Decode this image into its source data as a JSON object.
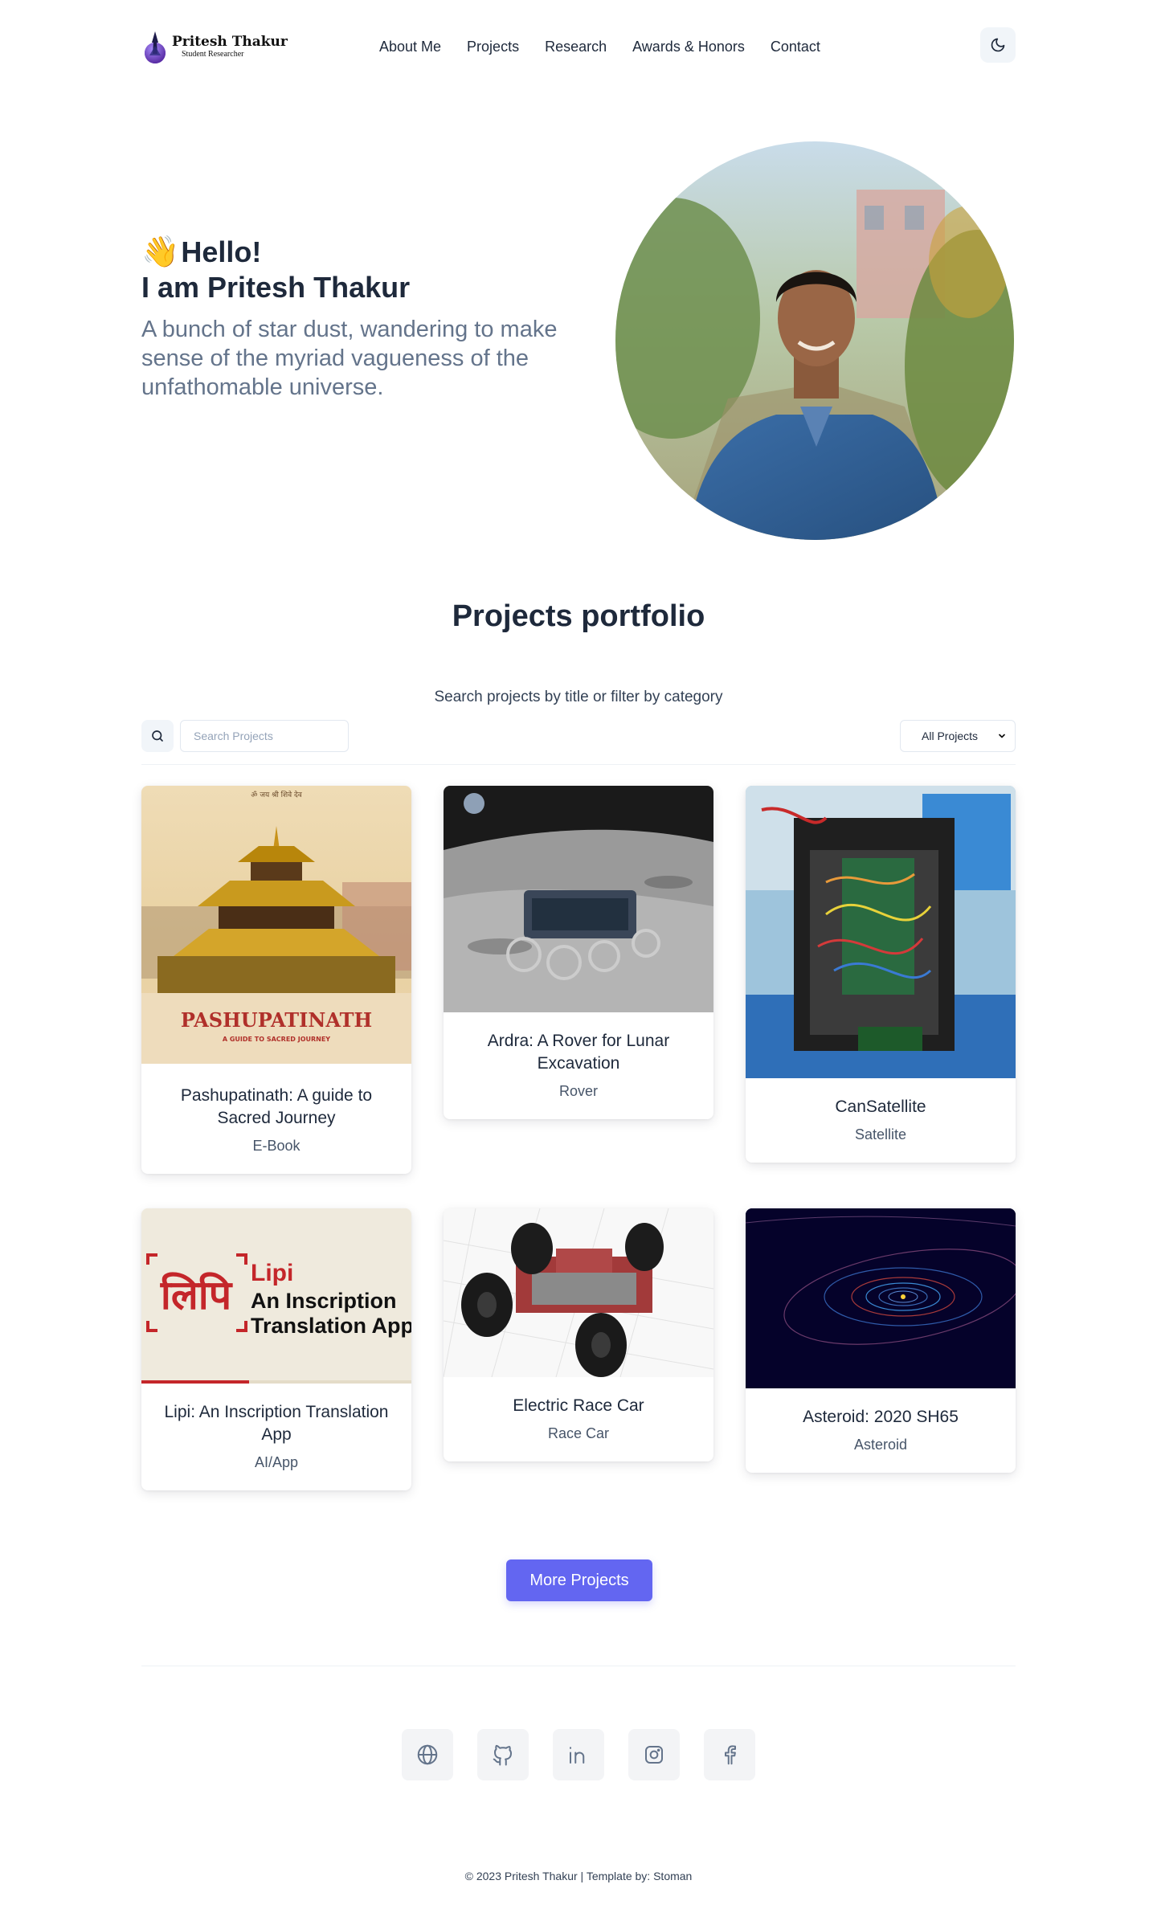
{
  "brand": {
    "name": "Pritesh Thakur",
    "subtitle": "Student Researcher",
    "accent": "#6366f1"
  },
  "nav": {
    "items": [
      "About Me",
      "Projects",
      "Research",
      "Awards & Honors",
      "Contact"
    ],
    "theme_toggle_icon": "moon-icon"
  },
  "hero": {
    "greeting_emoji": "👋",
    "greeting": "Hello!",
    "name_line": "I am Pritesh Thakur",
    "tagline": "A bunch of star dust, wandering to make sense of the myriad vagueness of the unfathomable universe."
  },
  "projects": {
    "title": "Projects portfolio",
    "search_hint": "Search projects by title or filter by category",
    "search_placeholder": "Search Projects",
    "filter_selected": "All Projects",
    "cards": [
      {
        "title": "Pashupatinath: A guide to Sacred Journey",
        "category": "E-Book",
        "cover_heading": "PASHUPATINATH",
        "cover_sub": "A GUIDE TO SACRED JOURNEY",
        "cover_top": "ॐ जय श्री शिवे देव"
      },
      {
        "title": "Ardra: A Rover for Lunar Excavation",
        "category": "Rover"
      },
      {
        "title": "CanSatellite",
        "category": "Satellite"
      },
      {
        "title": "Lipi: An Inscription Translation App",
        "category": "AI/App",
        "logo_word": "Lipi",
        "logo_line1": "An Inscription",
        "logo_line2": "Translation App",
        "logo_glyph": "लिपि"
      },
      {
        "title": "Electric Race Car",
        "category": "Race Car"
      },
      {
        "title": "Asteroid: 2020 SH65",
        "category": "Asteroid"
      }
    ],
    "more_button": "More Projects"
  },
  "socials": [
    "globe-icon",
    "github-icon",
    "linkedin-icon",
    "instagram-icon",
    "facebook-icon"
  ],
  "footer": {
    "text": "© 2023 Pritesh Thakur | Template by: ",
    "link": "Stoman"
  }
}
